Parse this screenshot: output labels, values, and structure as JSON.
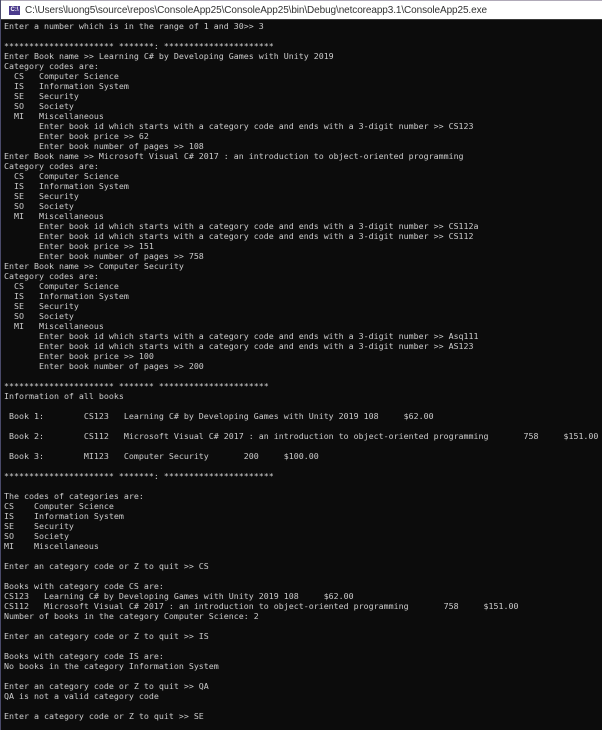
{
  "window": {
    "title": "C:\\Users\\luong5\\source\\repos\\ConsoleApp25\\ConsoleApp25\\bin\\Debug\\netcoreapp3.1\\ConsoleApp25.exe",
    "icon": "console-app-icon",
    "icon_label": "C:\\"
  },
  "console": {
    "lines": [
      "Enter a number which is in the range of 1 and 30>> 3",
      "",
      "********************** *******: **********************",
      "Enter Book name >> Learning C# by Developing Games with Unity 2019",
      "Category codes are:",
      "  CS   Computer Science",
      "  IS   Information System",
      "  SE   Security",
      "  SO   Society",
      "  MI   Miscellaneous",
      "       Enter book id which starts with a category code and ends with a 3-digit number >> CS123",
      "       Enter book price >> 62",
      "       Enter book number of pages >> 108",
      "Enter Book name >> Microsoft Visual C# 2017 : an introduction to object-oriented programming",
      "Category codes are:",
      "  CS   Computer Science",
      "  IS   Information System",
      "  SE   Security",
      "  SO   Society",
      "  MI   Miscellaneous",
      "       Enter book id which starts with a category code and ends with a 3-digit number >> CS112a",
      "       Enter book id which starts with a category code and ends with a 3-digit number >> CS112",
      "       Enter book price >> 151",
      "       Enter book number of pages >> 758",
      "Enter Book name >> Computer Security",
      "Category codes are:",
      "  CS   Computer Science",
      "  IS   Information System",
      "  SE   Security",
      "  SO   Society",
      "  MI   Miscellaneous",
      "       Enter book id which starts with a category code and ends with a 3-digit number >> Asq111",
      "       Enter book id which starts with a category code and ends with a 3-digit number >> AS123",
      "       Enter book price >> 100",
      "       Enter book number of pages >> 200",
      "",
      "********************** ******* **********************",
      "Information of all books",
      "",
      " Book 1:        CS123   Learning C# by Developing Games with Unity 2019 108     $62.00",
      "",
      " Book 2:        CS112   Microsoft Visual C# 2017 : an introduction to object-oriented programming       758     $151.00",
      "",
      " Book 3:        MI123   Computer Security       200     $100.00",
      "",
      "********************** *******: **********************",
      "",
      "The codes of categories are:",
      "CS    Computer Science",
      "IS    Information System",
      "SE    Security",
      "SO    Society",
      "MI    Miscellaneous",
      "",
      "Enter an category code or Z to quit >> CS",
      "",
      "Books with category code CS are:",
      "CS123   Learning C# by Developing Games with Unity 2019 108     $62.00",
      "CS112   Microsoft Visual C# 2017 : an introduction to object-oriented programming       758     $151.00",
      "Number of books in the category Computer Science: 2",
      "",
      "Enter an category code or Z to quit >> IS",
      "",
      "Books with category code IS are:",
      "No books in the category Information System",
      "",
      "Enter an category code or Z to quit >> QA",
      "QA is not a valid category code",
      "",
      "Enter a category code or Z to quit >> SE"
    ]
  }
}
